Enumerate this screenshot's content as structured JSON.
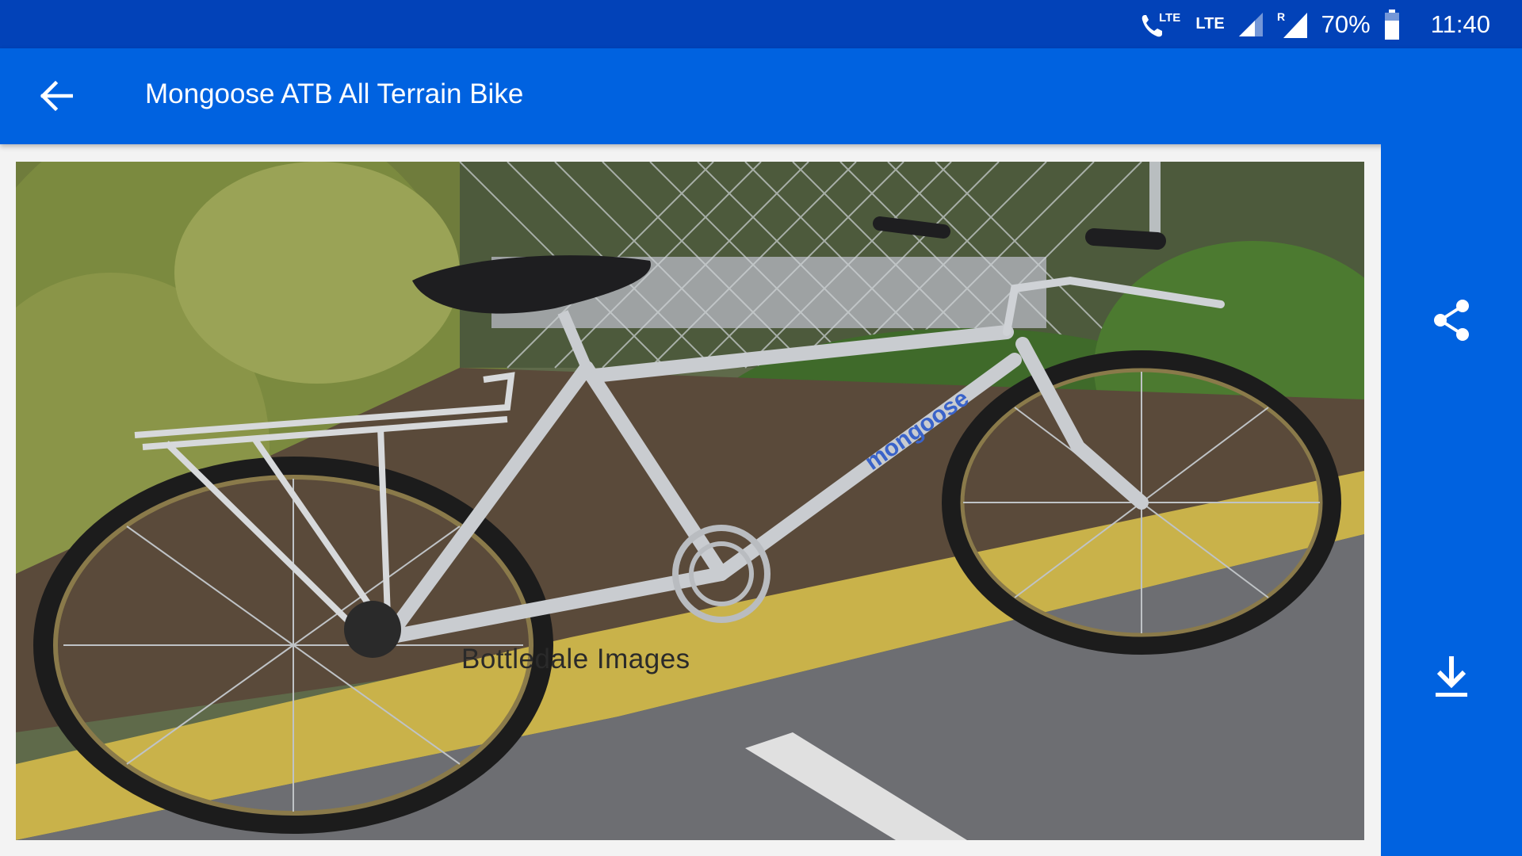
{
  "status_bar": {
    "lte_call": "LTE",
    "lte": "LTE",
    "roaming": "R",
    "battery": "70%",
    "time": "11:40"
  },
  "app_bar": {
    "title": "Mongoose ATB All Terrain Bike",
    "back_icon": "arrow-left-icon"
  },
  "side_actions": [
    {
      "icon": "share-icon"
    },
    {
      "icon": "download-icon"
    }
  ],
  "photo": {
    "watermark": "Bottledale Images",
    "frame_text": "mongoose"
  },
  "colors": {
    "status_bar": "#0242b8",
    "app_bar": "#0062e0",
    "icon": "#ffffff"
  }
}
